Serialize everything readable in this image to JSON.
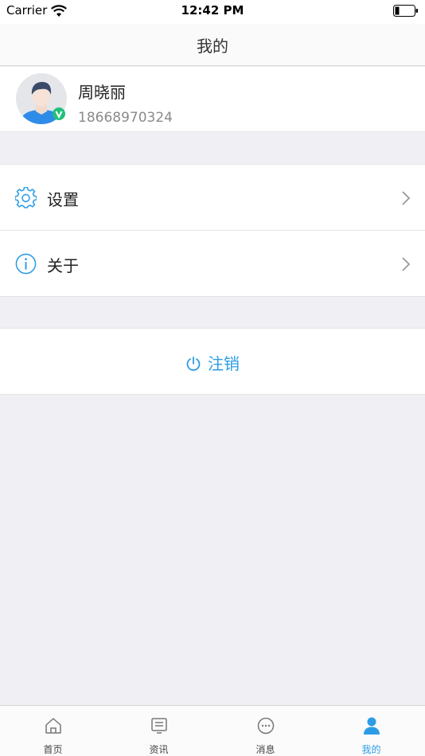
{
  "status_bar": {
    "carrier": "Carrier",
    "time": "12:42 PM"
  },
  "nav": {
    "title": "我的"
  },
  "profile": {
    "name": "周晓丽",
    "phone": "18668970324"
  },
  "menu": {
    "items": [
      {
        "label": "设置",
        "icon": "gear-icon"
      },
      {
        "label": "关于",
        "icon": "info-icon"
      }
    ]
  },
  "logout": {
    "label": "注销",
    "icon": "power-icon"
  },
  "tabs": [
    {
      "label": "首页",
      "icon": "home-icon"
    },
    {
      "label": "资讯",
      "icon": "news-icon"
    },
    {
      "label": "消息",
      "icon": "chat-icon"
    },
    {
      "label": "我的",
      "icon": "user-icon",
      "active": true
    }
  ],
  "colors": {
    "accent": "#2c9ce6",
    "background": "#efeff4"
  }
}
